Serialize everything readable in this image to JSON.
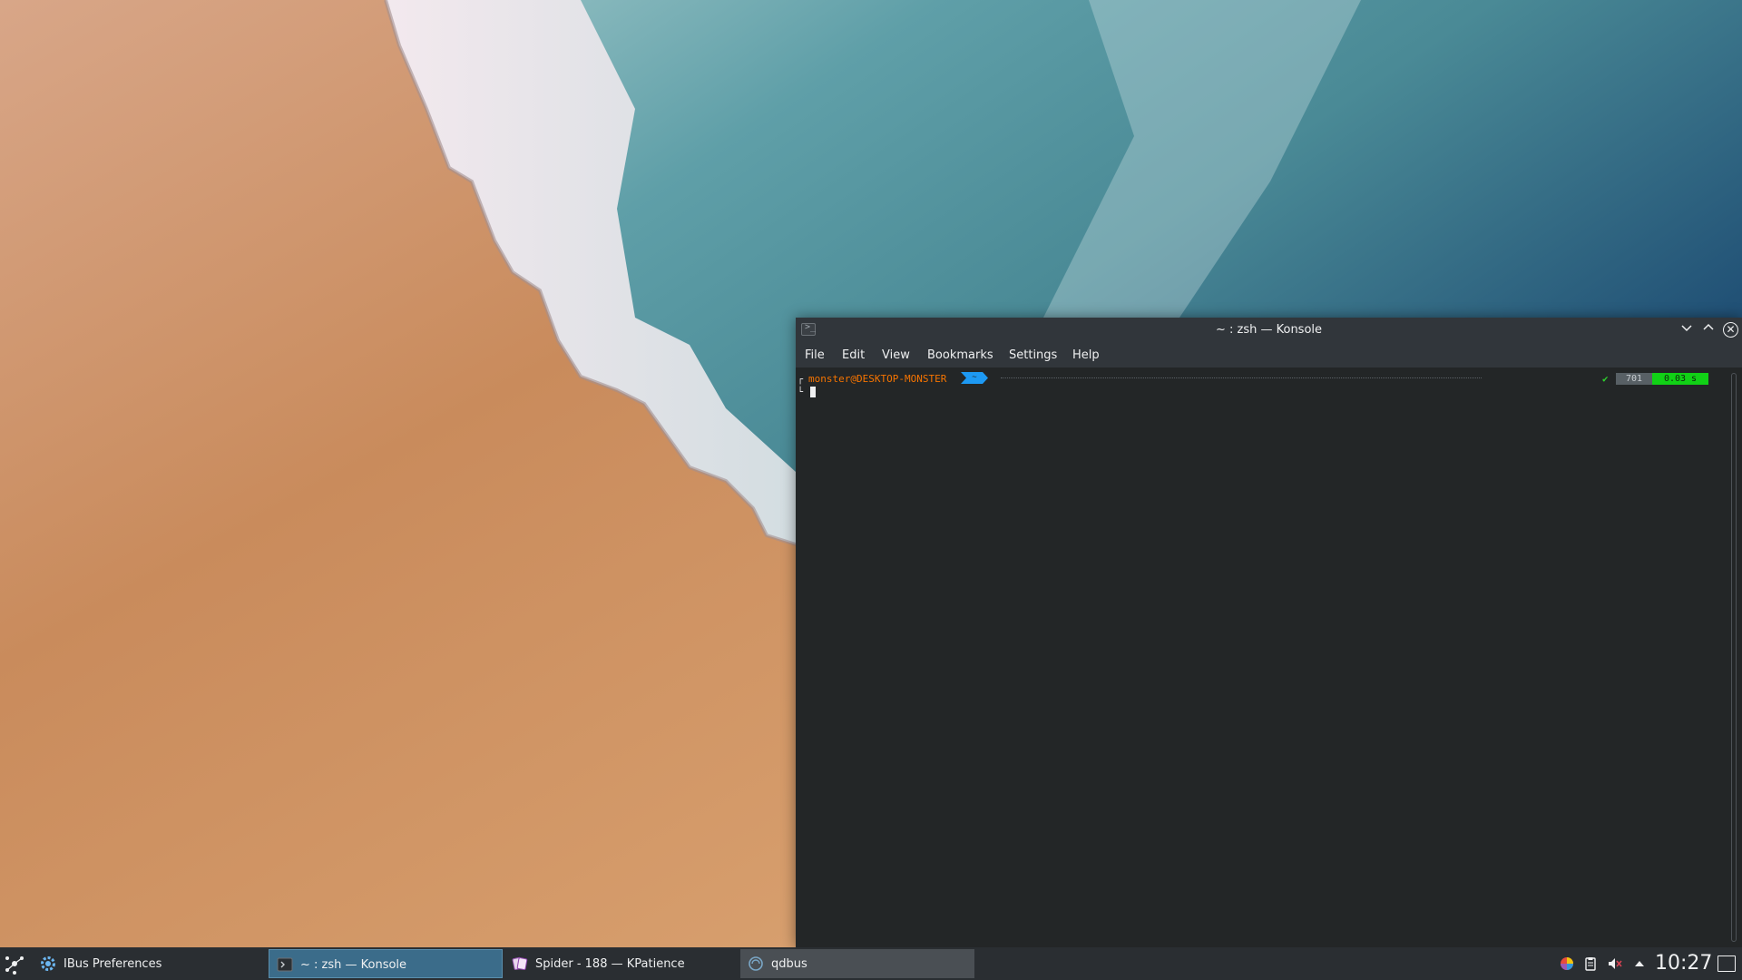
{
  "konsole": {
    "title": "~ : zsh — Konsole",
    "menu": [
      "File",
      "Edit",
      "View",
      "Bookmarks",
      "Settings",
      "Help"
    ],
    "prompt": {
      "user_host": "monster@DESKTOP-MONSTER",
      "dir": "~",
      "status_ok": "✔",
      "history": "701",
      "exec_time": "0.03 s"
    }
  },
  "taskbar": {
    "tasks": [
      {
        "label": "IBus Preferences"
      },
      {
        "label": "~ : zsh — Konsole"
      },
      {
        "label": "Spider - 188 — KPatience"
      },
      {
        "label": "qdbus"
      }
    ],
    "clock": "10:27"
  },
  "colors": {
    "panel": "#2a2e32",
    "window_bg": "#232627",
    "accent": "#1d99f3",
    "prompt_user": "#f67400",
    "exec_ok": "#11d116"
  },
  "icons": {
    "launcher": "kde-launcher-icon",
    "ibus": "gear-icon",
    "konsole": "terminal-icon",
    "kpat": "cards-icon",
    "qdbus": "qdbus-icon",
    "tray": [
      "color-picker-icon",
      "clipboard-icon",
      "volume-muted-icon",
      "expand-tray-icon"
    ]
  }
}
